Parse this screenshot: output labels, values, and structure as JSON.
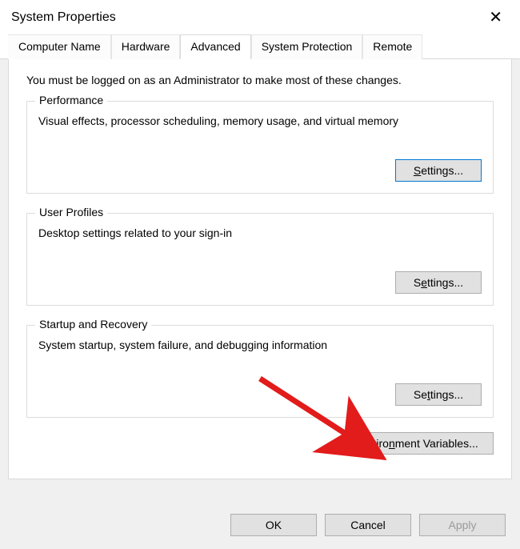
{
  "window": {
    "title": "System Properties",
    "close": "✕"
  },
  "tabs": [
    "Computer Name",
    "Hardware",
    "Advanced",
    "System Protection",
    "Remote"
  ],
  "active_tab": "Advanced",
  "intro": "You must be logged on as an Administrator to make most of these changes.",
  "groups": {
    "performance": {
      "legend": "Performance",
      "desc": "Visual effects, processor scheduling, memory usage, and virtual memory",
      "button": "Settings..."
    },
    "profiles": {
      "legend": "User Profiles",
      "desc": "Desktop settings related to your sign-in",
      "button": "Settings..."
    },
    "startup": {
      "legend": "Startup and Recovery",
      "desc": "System startup, system failure, and debugging information",
      "button": "Settings..."
    }
  },
  "env_button": "Environment Variables...",
  "bottom": {
    "ok": "OK",
    "cancel": "Cancel",
    "apply": "Apply"
  },
  "arrow_color": "#e21b1b"
}
